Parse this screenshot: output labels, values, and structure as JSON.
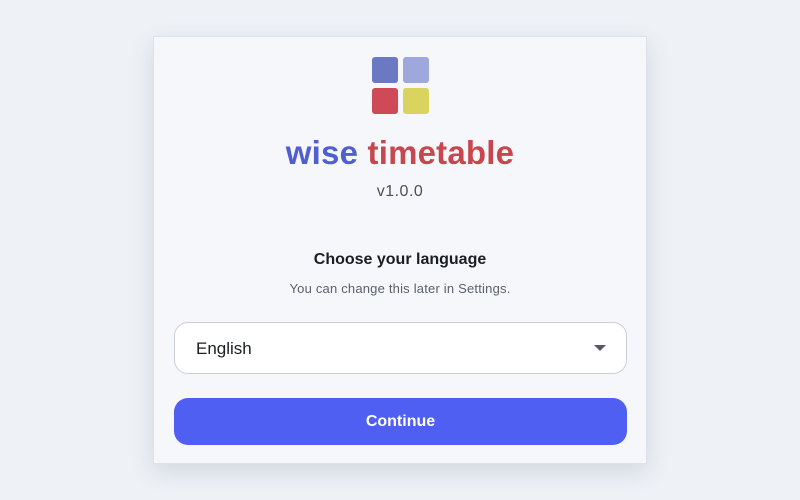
{
  "logo": {
    "colors": {
      "top_left": "#6b78c2",
      "top_right": "#9ea8dc",
      "bottom_left": "#cd4a56",
      "bottom_right": "#d9d45e"
    }
  },
  "brand": {
    "word1": "wise",
    "word2": "timetable",
    "word1_color": "#4f5fd1",
    "word2_color": "#c8474f"
  },
  "version": "v1.0.0",
  "language": {
    "heading": "Choose your language",
    "subtext": "You can change this later in Settings.",
    "selected": "English"
  },
  "actions": {
    "continue_label": "Continue",
    "accent": "#4f5ff2"
  }
}
